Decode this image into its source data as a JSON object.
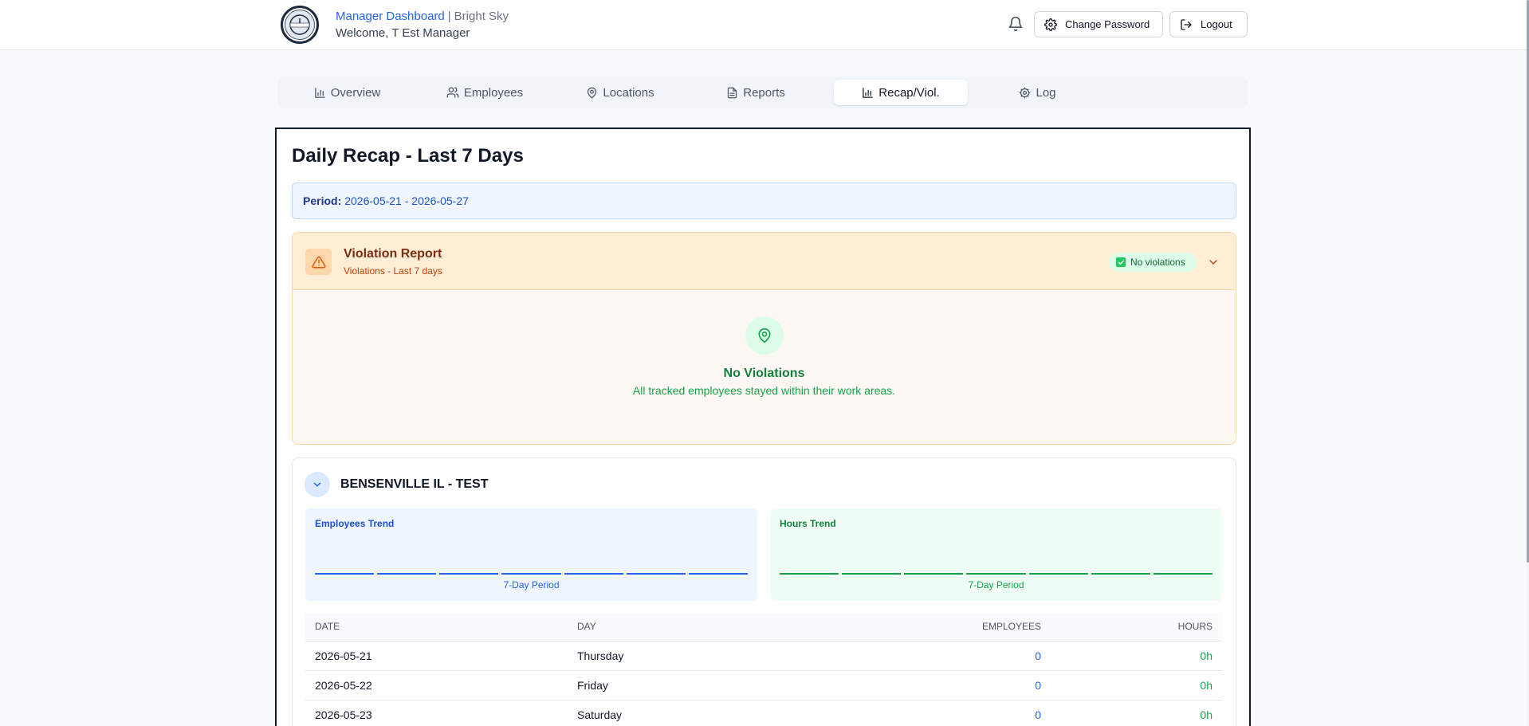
{
  "header": {
    "logo_text": "CLOCK-ME",
    "title": "Manager Dashboard",
    "company": "Bright Sky",
    "welcome": "Welcome, T Est Manager",
    "change_password_label": "Change Password",
    "logout_label": "Logout"
  },
  "tabs": [
    {
      "label": "Overview",
      "icon": "bar-chart-icon",
      "active": false
    },
    {
      "label": "Employees",
      "icon": "users-icon",
      "active": false
    },
    {
      "label": "Locations",
      "icon": "map-pin-icon",
      "active": false
    },
    {
      "label": "Reports",
      "icon": "file-text-icon",
      "active": false
    },
    {
      "label": "Recap/Viol.",
      "icon": "bar-chart-icon",
      "active": true
    },
    {
      "label": "Log",
      "icon": "gear-icon",
      "active": false
    }
  ],
  "main": {
    "title": "Daily Recap - Last 7 Days",
    "period_label": "Period:",
    "period_value": "2026-05-21 - 2026-05-27"
  },
  "violations": {
    "title": "Violation Report",
    "subtitle": "Violations - Last 7 days",
    "badge": "No violations",
    "empty_title": "No Violations",
    "empty_text": "All tracked employees stayed within their work areas."
  },
  "location": {
    "name": "BENSENVILLE IL - TEST",
    "employees_trend_label": "Employees Trend",
    "hours_trend_label": "Hours Trend",
    "trend_footer": "7-Day Period",
    "columns": [
      "DATE",
      "DAY",
      "EMPLOYEES",
      "HOURS"
    ],
    "rows": [
      {
        "date": "2026-05-21",
        "day": "Thursday",
        "employees": "0",
        "hours": "0h"
      },
      {
        "date": "2026-05-22",
        "day": "Friday",
        "employees": "0",
        "hours": "0h"
      },
      {
        "date": "2026-05-23",
        "day": "Saturday",
        "employees": "0",
        "hours": "0h"
      }
    ]
  },
  "colors": {
    "accent": "#2563eb",
    "success": "#16a34a",
    "warning_bg": "#ffedd5",
    "warning_text": "#7c2d12"
  }
}
